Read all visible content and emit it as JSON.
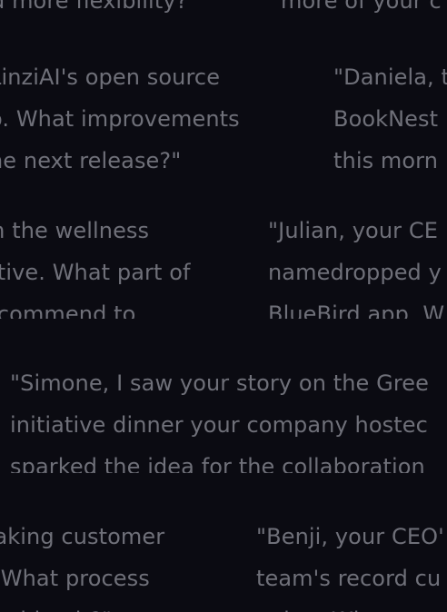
{
  "cards": {
    "c0a": {
      "lines": [
        "d more flexibility?\""
      ]
    },
    "c0b": {
      "lines": [
        "more of your c"
      ]
    },
    "c1a": {
      "lines": [
        "LinziAI's open source",
        "o. What improvements",
        "he next release?\""
      ]
    },
    "c1b": {
      "lines": [
        "\"Daniela, t",
        "BookNest",
        "this morn"
      ]
    },
    "c2a": {
      "lines": [
        "m the wellness",
        "ative. What part of",
        "ecommend to"
      ]
    },
    "c2b": {
      "lines": [
        "\"Julian, your CE",
        "namedropped y",
        "BlueBird app. W"
      ]
    },
    "c3a": {
      "lines": [
        "\"Simone, I saw your story on the Gree",
        "initiative dinner your company hostec",
        "sparked the idea for the collaboration"
      ]
    },
    "c4a": {
      "lines": [
        "making customer",
        "n. What process",
        "roaching it?\""
      ]
    },
    "c4b": {
      "lines": [
        "\"Benji, your CEO'",
        "team's record cu",
        "going. What w"
      ]
    }
  }
}
